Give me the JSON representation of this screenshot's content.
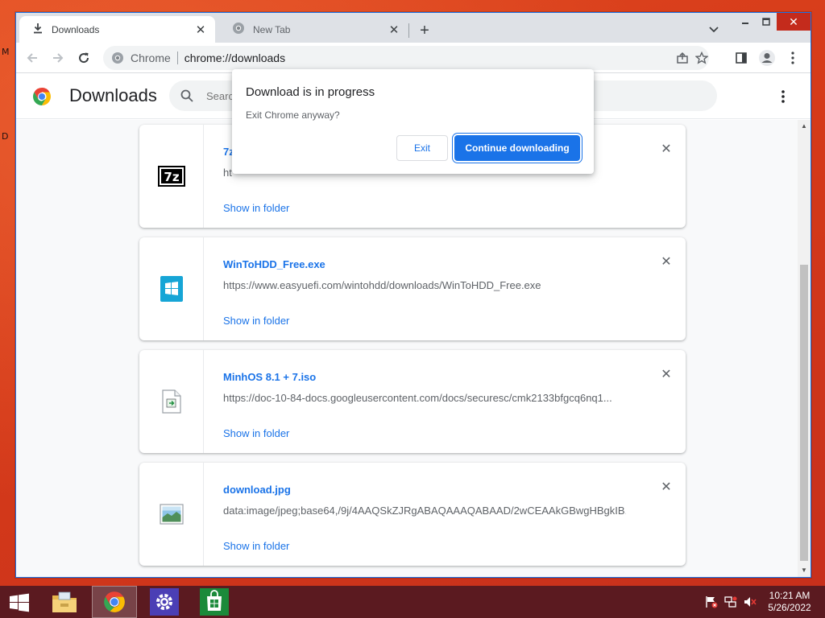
{
  "colors": {
    "accent": "#1a73e8",
    "desktop": "#d8401c",
    "taskbar": "#5b1a20",
    "close_red": "#c42b1c"
  },
  "browser": {
    "tabs": [
      {
        "title": "Downloads",
        "icon": "download-icon",
        "active": true
      },
      {
        "title": "New Tab",
        "icon": "chrome-icon",
        "active": false
      }
    ],
    "omnibox": {
      "site_label": "Chrome",
      "url": "chrome://downloads"
    }
  },
  "page": {
    "title": "Downloads",
    "search_placeholder": "Search downloads"
  },
  "downloads": [
    {
      "name": "7z",
      "url": "ht",
      "action": "Show in folder",
      "icon": "7z-file-icon"
    },
    {
      "name": "WinToHDD_Free.exe",
      "url": "https://www.easyuefi.com/wintohdd/downloads/WinToHDD_Free.exe",
      "action": "Show in folder",
      "icon": "windows-exe-icon"
    },
    {
      "name": "MinhOS 8.1 + 7.iso",
      "url": "https://doc-10-84-docs.googleusercontent.com/docs/securesc/cmk2133bfgcq6nq1...",
      "action": "Show in folder",
      "icon": "disc-image-file-icon"
    },
    {
      "name": "download.jpg",
      "url": "data:image/jpeg;base64,/9j/4AAQSkZJRgABAQAAAQABAAD/2wCEAAkGBwgHBgkIB...",
      "action": "Show in folder",
      "icon": "image-file-icon"
    }
  ],
  "dialog": {
    "title": "Download is in progress",
    "message": "Exit Chrome anyway?",
    "exit_label": "Exit",
    "continue_label": "Continue downloading"
  },
  "taskbar": {
    "apps": [
      "file-explorer-icon",
      "chrome-icon",
      "settings-icon",
      "store-icon"
    ],
    "time": "10:21 AM",
    "date": "5/26/2022"
  }
}
